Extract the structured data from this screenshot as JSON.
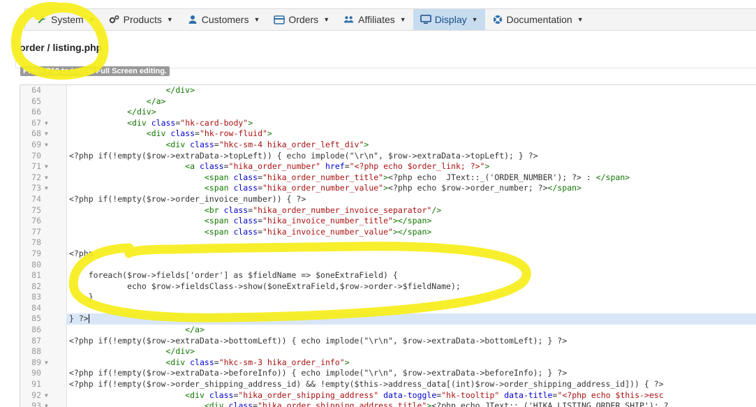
{
  "nav": {
    "items": [
      {
        "label": "System",
        "icon": "wrench-icon"
      },
      {
        "label": "Products",
        "icon": "cogs-icon"
      },
      {
        "label": "Customers",
        "icon": "user-icon"
      },
      {
        "label": "Orders",
        "icon": "credit-card-icon"
      },
      {
        "label": "Affiliates",
        "icon": "users-icon"
      },
      {
        "label": "Display",
        "icon": "monitor-icon"
      },
      {
        "label": "Documentation",
        "icon": "lifebuoy-icon"
      }
    ]
  },
  "page": {
    "title": "order / listing.php",
    "hint": "Press F10 to toggle Full Screen editing."
  },
  "colors": {
    "accent": "#c8dcf0",
    "highlighter": "#f6ee1a"
  },
  "editor": {
    "active_line": "85",
    "lines": [
      {
        "n": "64",
        "f": "",
        "html": "                    <span class='tag'>&lt;/div&gt;</span>"
      },
      {
        "n": "65",
        "f": "",
        "html": "                <span class='tag'>&lt;/a&gt;</span>"
      },
      {
        "n": "66",
        "f": "",
        "html": "            <span class='tag'>&lt;/div&gt;</span>"
      },
      {
        "n": "67",
        "f": "▼",
        "html": "            <span class='tag'>&lt;div</span> <span class='attr'>class</span>=<span class='str'>\"hk-card-body\"</span><span class='tag'>&gt;</span>"
      },
      {
        "n": "68",
        "f": "▼",
        "html": "                <span class='tag'>&lt;div</span> <span class='attr'>class</span>=<span class='str'>\"hk-row-fluid\"</span><span class='tag'>&gt;</span>"
      },
      {
        "n": "69",
        "f": "▼",
        "html": "                    <span class='tag'>&lt;div</span> <span class='attr'>class</span>=<span class='str'>\"hkc-sm-4 hika_order_left_div\"</span><span class='tag'>&gt;</span>"
      },
      {
        "n": "70",
        "f": "",
        "html": "&lt;?php if(!empty($row-&gt;extraData-&gt;topLeft)) { echo implode(\"\\r\\n\", $row-&gt;extraData-&gt;topLeft); } ?&gt;"
      },
      {
        "n": "71",
        "f": "▼",
        "html": "                        <span class='tag'>&lt;a</span> <span class='attr'>class</span>=<span class='str'>\"hika_order_number\"</span> <span class='attr'>href</span>=<span class='str'>\"&lt;?php echo $order_link; ?&gt;\"</span><span class='tag'>&gt;</span>"
      },
      {
        "n": "72",
        "f": "▼",
        "html": "                            <span class='tag'>&lt;span</span> <span class='attr'>class</span>=<span class='str'>\"hika_order_number_title\"</span><span class='tag'>&gt;</span>&lt;?php echo  JText::_('ORDER_NUMBER'); ?&gt; : <span class='tag'>&lt;/span&gt;</span>"
      },
      {
        "n": "73",
        "f": "▼",
        "html": "                            <span class='tag'>&lt;span</span> <span class='attr'>class</span>=<span class='str'>\"hika_order_number_value\"</span><span class='tag'>&gt;</span>&lt;?php echo $row-&gt;order_number; ?&gt;<span class='tag'>&lt;/span&gt;</span>"
      },
      {
        "n": "74",
        "f": "",
        "html": "&lt;?php if(!empty($row-&gt;order_invoice_number)) { ?&gt;"
      },
      {
        "n": "75",
        "f": "",
        "html": "                            <span class='tag'>&lt;br</span> <span class='attr'>class</span>=<span class='str'>\"hika_order_number_invoice_separator\"</span><span class='tag'>/&gt;</span>"
      },
      {
        "n": "76",
        "f": "",
        "html": "                            <span class='tag'>&lt;span</span> <span class='attr'>class</span>=<span class='str'>\"hika_invoice_number_title\"</span><span class='tag'>&gt;&lt;/span&gt;</span>"
      },
      {
        "n": "77",
        "f": "",
        "html": "                            <span class='tag'>&lt;span</span> <span class='attr'>class</span>=<span class='str'>\"hika_invoice_number_value\"</span><span class='tag'>&gt;&lt;/span&gt;</span>"
      },
      {
        "n": "78",
        "f": "",
        "html": ""
      },
      {
        "n": "79",
        "f": "",
        "html": "&lt;?php"
      },
      {
        "n": "80",
        "f": "",
        "html": ""
      },
      {
        "n": "81",
        "f": "",
        "html": "    foreach($row-&gt;fields['order'] as $fieldName =&gt; $oneExtraField) {"
      },
      {
        "n": "82",
        "f": "",
        "html": "            echo $row-&gt;fieldsClass-&gt;show($oneExtraField,$row-&gt;order-&gt;$fieldName);"
      },
      {
        "n": "83",
        "f": "",
        "html": "    }"
      },
      {
        "n": "84",
        "f": "",
        "html": ""
      },
      {
        "n": "85",
        "f": "",
        "html": "} ?&gt;<span class='cursor'></span>"
      },
      {
        "n": "86",
        "f": "",
        "html": "                        <span class='tag'>&lt;/a&gt;</span>"
      },
      {
        "n": "87",
        "f": "",
        "html": "&lt;?php if(!empty($row-&gt;extraData-&gt;bottomLeft)) { echo implode(\"\\r\\n\", $row-&gt;extraData-&gt;bottomLeft); } ?&gt;"
      },
      {
        "n": "88",
        "f": "",
        "html": "                    <span class='tag'>&lt;/div&gt;</span>"
      },
      {
        "n": "89",
        "f": "▼",
        "html": "                    <span class='tag'>&lt;div</span> <span class='attr'>class</span>=<span class='str'>\"hkc-sm-3 hika_order_info\"</span><span class='tag'>&gt;</span>"
      },
      {
        "n": "90",
        "f": "",
        "html": "&lt;?php if(!empty($row-&gt;extraData-&gt;beforeInfo)) { echo implode(\"\\r\\n\", $row-&gt;extraData-&gt;beforeInfo); } ?&gt;"
      },
      {
        "n": "91",
        "f": "",
        "html": "&lt;?php if(!empty($row-&gt;order_shipping_address_id) &amp;&amp; !empty($this-&gt;address_data[(int)$row-&gt;order_shipping_address_id])) { ?&gt;"
      },
      {
        "n": "92",
        "f": "▼",
        "html": "                        <span class='tag'>&lt;div</span> <span class='attr'>class</span>=<span class='str'>\"hika_order_shipping_address\"</span> <span class='attr'>data-toggle</span>=<span class='str'>\"hk-tooltip\"</span> <span class='attr'>data-title</span>=<span class='str'>\"&lt;?php echo $this-&gt;esc</span>"
      },
      {
        "n": "93",
        "f": "▼",
        "html": "                            <span class='tag'>&lt;div</span> <span class='attr'>class</span>=<span class='str'>\"hika_order_shipping_address_title\"</span><span class='tag'>&gt;</span>&lt;?php echo JText::_('HIKA_LISTING_ORDER_SHIP'); ?"
      }
    ]
  }
}
